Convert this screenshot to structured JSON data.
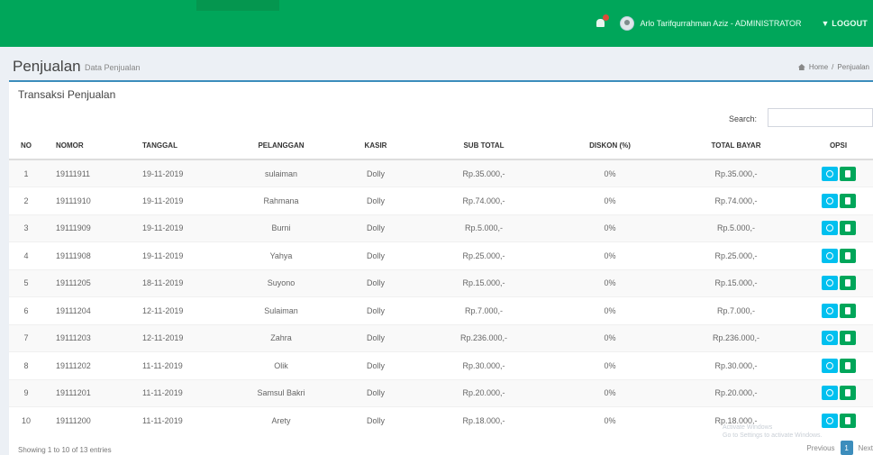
{
  "topbar": {
    "user_name": "Arlo Tarifqurrahman Aziz - ADMINISTRATOR",
    "logout_label": "LOGOUT",
    "brand_color": "#00a65a"
  },
  "header": {
    "title": "Penjualan",
    "subtitle": "Data Penjualan",
    "breadcrumb": [
      "Home",
      "Penjualan"
    ]
  },
  "box": {
    "title": "Transaksi Penjualan",
    "search_label": "Search:",
    "search_value": ""
  },
  "table": {
    "columns": [
      "NO",
      "NOMOR",
      "TANGGAL",
      "PELANGGAN",
      "KASIR",
      "SUB TOTAL",
      "DISKON (%)",
      "TOTAL BAYAR",
      "OPSI"
    ],
    "rows": [
      [
        "1",
        "19111911",
        "19-11-2019",
        "sulaiman",
        "Dolly",
        "Rp.35.000,-",
        "0%",
        "Rp.35.000,-"
      ],
      [
        "2",
        "19111910",
        "19-11-2019",
        "Rahmana",
        "Dolly",
        "Rp.74.000,-",
        "0%",
        "Rp.74.000,-"
      ],
      [
        "3",
        "19111909",
        "19-11-2019",
        "Burni",
        "Dolly",
        "Rp.5.000,-",
        "0%",
        "Rp.5.000,-"
      ],
      [
        "4",
        "19111908",
        "19-11-2019",
        "Yahya",
        "Dolly",
        "Rp.25.000,-",
        "0%",
        "Rp.25.000,-"
      ],
      [
        "5",
        "19111205",
        "18-11-2019",
        "Suyono",
        "Dolly",
        "Rp.15.000,-",
        "0%",
        "Rp.15.000,-"
      ],
      [
        "6",
        "19111204",
        "12-11-2019",
        "Sulaiman",
        "Dolly",
        "Rp.7.000,-",
        "0%",
        "Rp.7.000,-"
      ],
      [
        "7",
        "19111203",
        "12-11-2019",
        "Zahra",
        "Dolly",
        "Rp.236.000,-",
        "0%",
        "Rp.236.000,-"
      ],
      [
        "8",
        "19111202",
        "11-11-2019",
        "Olik",
        "Dolly",
        "Rp.30.000,-",
        "0%",
        "Rp.30.000,-"
      ],
      [
        "9",
        "19111201",
        "11-11-2019",
        "Samsul Bakri",
        "Dolly",
        "Rp.20.000,-",
        "0%",
        "Rp.20.000,-"
      ],
      [
        "10",
        "19111200",
        "11-11-2019",
        "Arety",
        "Dolly",
        "Rp.18.000,-",
        "0%",
        "Rp.18.000,-"
      ]
    ]
  },
  "footer": {
    "info": "Showing 1 to 10 of 13 entries",
    "prev_label": "Previous",
    "current_page": "1",
    "next_label": "Next",
    "ghost_text": "Activate Windows\nGo to Settings to activate Windows."
  },
  "icons": {
    "bell": "bell-icon",
    "home": "home-icon",
    "view": "search-icon",
    "edit": "document-icon"
  }
}
